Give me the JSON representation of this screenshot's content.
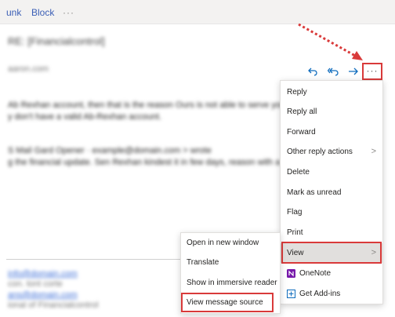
{
  "toolbar": {
    "junk": "unk",
    "block": "Block",
    "more": "···"
  },
  "email": {
    "subject_blur": "RE: [Financialcontrol]",
    "from_blur": "aaron.com",
    "body_line1": "Ab Rexhan account, then that is the reason Ours is not able to serve you. We",
    "body_line2": "y don't have a valid Ab-Rexhan account.",
    "quote_line1": "S Mail Gard Opener · example@domain.com > wrote",
    "quote_line2": "g the financial update. Sen Rexhan kindest it in few days, reason with a",
    "sig1": "info@domain.com",
    "sig2": "con. tont corte",
    "sig3": "ans@domain.com",
    "sig4": "ional of Financialcontrol"
  },
  "actions": {
    "more": "···"
  },
  "menu": {
    "items": [
      {
        "label": "Reply"
      },
      {
        "label": "Reply all"
      },
      {
        "label": "Forward"
      },
      {
        "label": "Other reply actions",
        "chevron": ">"
      },
      {
        "label": "Delete"
      },
      {
        "label": "Mark as unread"
      },
      {
        "label": "Flag"
      },
      {
        "label": "Print"
      },
      {
        "label": "View",
        "chevron": ">"
      },
      {
        "label": "OneNote"
      },
      {
        "label": "Get Add-ins"
      }
    ]
  },
  "submenu": {
    "items": [
      {
        "label": "Open in new window"
      },
      {
        "label": "Translate"
      },
      {
        "label": "Show in immersive reader"
      },
      {
        "label": "View message source"
      }
    ]
  },
  "colors": {
    "accent": "#0f6cbd",
    "highlight": "#d93a3a",
    "onenote": "#7719aa"
  }
}
